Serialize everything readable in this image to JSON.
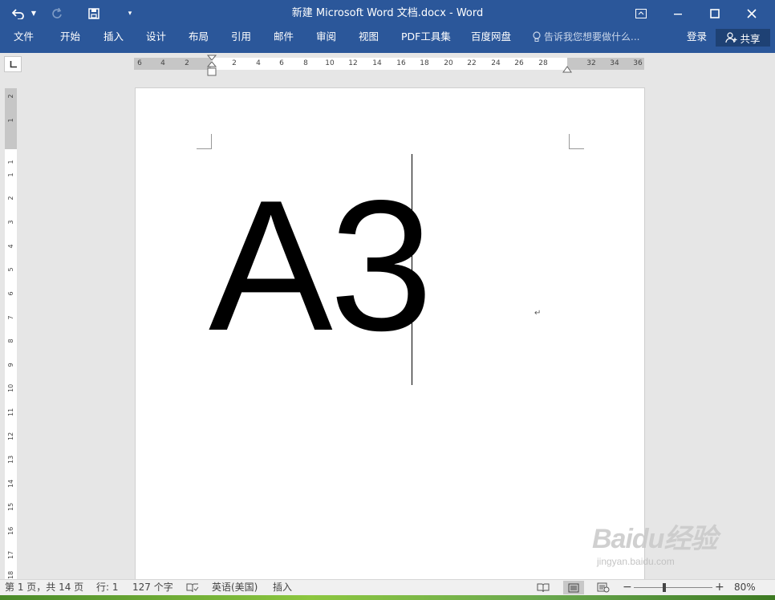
{
  "titlebar": {
    "title": "新建 Microsoft Word 文档.docx - Word"
  },
  "ribbon": {
    "tabs": [
      "文件",
      "开始",
      "插入",
      "设计",
      "布局",
      "引用",
      "邮件",
      "审阅",
      "视图",
      "PDF工具集",
      "百度网盘"
    ],
    "tell_me": "告诉我您想要做什么...",
    "sign_in": "登录",
    "share": "共享"
  },
  "ruler": {
    "horizontal_labels": [
      "6",
      "4",
      "2",
      "2",
      "4",
      "6",
      "8",
      "10",
      "12",
      "14",
      "16",
      "18",
      "20",
      "22",
      "24",
      "26",
      "28",
      "32",
      "34",
      "36"
    ],
    "vertical_labels": [
      "2",
      "1",
      "1",
      "1",
      "2",
      "3",
      "4",
      "5",
      "6",
      "7",
      "8",
      "9",
      "10",
      "11",
      "12",
      "13",
      "14",
      "15",
      "16",
      "17",
      "18"
    ]
  },
  "document": {
    "text": "A3",
    "paragraph_mark": "↵"
  },
  "statusbar": {
    "page": "第 1 页，共 14 页",
    "line": "行: 1",
    "words": "127 个字",
    "language": "英语(美国)",
    "mode": "插入",
    "zoom": "80%",
    "zoom_level_percent": 80
  },
  "watermark": {
    "brand": "Baidu经验",
    "url": "jingyan.baidu.com"
  }
}
